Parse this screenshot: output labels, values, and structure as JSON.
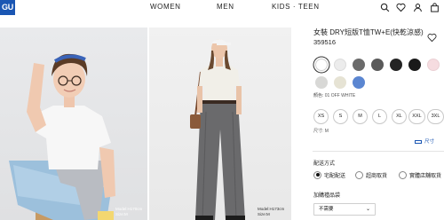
{
  "header": {
    "logo": "GU",
    "nav": [
      "WOMEN",
      "MEN",
      "KIDS · TEEN"
    ],
    "icons": [
      "search-icon",
      "heart-icon",
      "user-icon",
      "bag-icon"
    ]
  },
  "photos": [
    {
      "model_info_line1": "Model:H170cm",
      "model_info_line2": "Size:M"
    },
    {
      "model_info_line1": "Model:H173cm",
      "model_info_line2": "Size:M"
    }
  ],
  "product": {
    "title": "女裝 DRY短版T恤TW+E(快乾涼感)",
    "code": "359516",
    "colors": {
      "row1": [
        "#ffffff",
        "#ececec",
        "#6b6b6b",
        "#5a5a5a",
        "#242424",
        "#1a1a1a",
        "#f6dce0"
      ],
      "row2": [
        "#d8d8d6",
        "#e6e3d4",
        "#5b86d1"
      ],
      "selected_label": "顏色: 01 OFF WHITE"
    },
    "sizes": [
      "XS",
      "S",
      "M",
      "L",
      "XL",
      "XXL",
      "3XL"
    ],
    "size_label": "尺寸: M",
    "size_guide": "尺寸"
  },
  "delivery": {
    "label": "配送方式",
    "options": [
      "宅配配送",
      "超商取貨",
      "實體店舖取貨"
    ],
    "selected_index": 0
  },
  "gift_bag": {
    "label": "加購禮品袋",
    "value": "不需要"
  }
}
